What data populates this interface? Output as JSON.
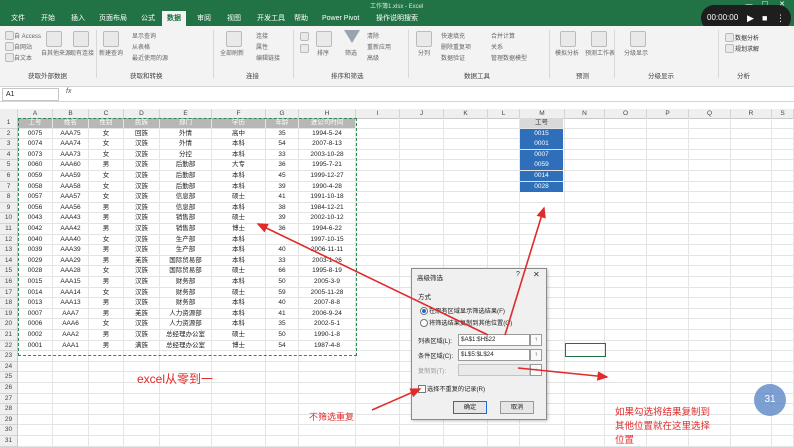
{
  "window": {
    "title": "工作簿1.xlsx - Excel",
    "controls": [
      "—",
      "☐",
      "✕"
    ]
  },
  "tabs": [
    "文件",
    "开始",
    "插入",
    "页面布局",
    "公式",
    "数据",
    "审阅",
    "视图",
    "开发工具",
    "帮助",
    "Power Pivot",
    "操作说明搜索"
  ],
  "active_tab": "数据",
  "video": {
    "time": "00:00:00"
  },
  "ribbon": {
    "groups": [
      "获取外部数据",
      "获取和转换",
      "连接",
      "排序和筛选",
      "数据工具",
      "预测",
      "分级显示",
      "分析"
    ],
    "items": {
      "access": "自 Access",
      "web": "自网站",
      "text": "自文本",
      "other": "自其他来源",
      "existing": "现有连接",
      "new_query": "新建查询",
      "show_query": "显示查询",
      "from_table": "从表格",
      "recent": "最近使用的源",
      "refresh": "全部刷新",
      "conn": "连接",
      "props": "属性",
      "edit_links": "编辑链接",
      "sort": "排序",
      "filter": "筛选",
      "clear": "清除",
      "reapply": "重新应用",
      "advanced": "高级",
      "split": "分列",
      "flash_fill": "快速填充",
      "remove_dup": "删除重复项",
      "validation": "数据验证",
      "consolidate": "合并计算",
      "relations": "关系",
      "manage_model": "管理数据模型",
      "what_if": "模拟分析",
      "forecast": "预测工作表",
      "outline": "分级显示",
      "data_analysis": "数据分析",
      "solver": "规划求解"
    }
  },
  "formula_bar": {
    "name_box": "A1",
    "fx": "fx"
  },
  "columns": [
    "A",
    "B",
    "C",
    "D",
    "E",
    "F",
    "G",
    "H",
    "I",
    "J",
    "K",
    "L",
    "M",
    "N",
    "O",
    "P",
    "Q",
    "R",
    "S"
  ],
  "rows": [
    "1",
    "2",
    "3",
    "4",
    "5",
    "6",
    "7",
    "8",
    "9",
    "10",
    "11",
    "12",
    "13",
    "14",
    "15",
    "16",
    "17",
    "18",
    "19",
    "20",
    "21",
    "22",
    "23",
    "24",
    "25",
    "26",
    "27",
    "28",
    "29",
    "30",
    "31"
  ],
  "table": {
    "headers": [
      "工号",
      "姓名",
      "性别",
      "民族",
      "部门",
      "学历",
      "年龄",
      "进公司时间"
    ],
    "rows": [
      [
        "0075",
        "AAA75",
        "女",
        "回族",
        "外情",
        "高中",
        "35",
        "1994-5-24"
      ],
      [
        "0074",
        "AAA74",
        "女",
        "汉族",
        "外情",
        "本科",
        "54",
        "2007-8-13"
      ],
      [
        "0073",
        "AAA73",
        "女",
        "汉族",
        "分控",
        "本科",
        "33",
        "2003-10-28"
      ],
      [
        "0060",
        "AAA60",
        "男",
        "汉族",
        "后勤部",
        "大专",
        "36",
        "1995-7-21"
      ],
      [
        "0059",
        "AAA59",
        "女",
        "汉族",
        "后勤部",
        "本科",
        "45",
        "1999-12-27"
      ],
      [
        "0058",
        "AAA58",
        "女",
        "汉族",
        "后勤部",
        "本科",
        "39",
        "1990-4-28"
      ],
      [
        "0057",
        "AAA57",
        "女",
        "汉族",
        "信息部",
        "硕士",
        "41",
        "1991-10-18"
      ],
      [
        "0056",
        "AAA56",
        "男",
        "汉族",
        "信息部",
        "本科",
        "38",
        "1984-12-21"
      ],
      [
        "0043",
        "AAA43",
        "男",
        "汉族",
        "销售部",
        "硕士",
        "39",
        "2002-10-12"
      ],
      [
        "0042",
        "AAA42",
        "男",
        "汉族",
        "销售部",
        "博士",
        "36",
        "1994-6-22"
      ],
      [
        "0040",
        "AAA40",
        "女",
        "汉族",
        "生产部",
        "本科",
        "",
        "1997-10-15"
      ],
      [
        "0039",
        "AAA39",
        "男",
        "汉族",
        "生产部",
        "本科",
        "40",
        "2006-11-11"
      ],
      [
        "0029",
        "AAA29",
        "男",
        "羌族",
        "国际贸易部",
        "本科",
        "33",
        "2003-1-26"
      ],
      [
        "0028",
        "AAA28",
        "女",
        "汉族",
        "国际贸易部",
        "硕士",
        "66",
        "1995-8-19"
      ],
      [
        "0015",
        "AAA15",
        "男",
        "汉族",
        "财务部",
        "本科",
        "50",
        "2005-3-9"
      ],
      [
        "0014",
        "AAA14",
        "女",
        "汉族",
        "财务部",
        "硕士",
        "59",
        "2005-11-28"
      ],
      [
        "0013",
        "AAA13",
        "男",
        "汉族",
        "财务部",
        "本科",
        "40",
        "2007-8-8"
      ],
      [
        "0007",
        "AAA7",
        "男",
        "羌族",
        "人力资源部",
        "本科",
        "41",
        "2006-9-24"
      ],
      [
        "0006",
        "AAA6",
        "女",
        "汉族",
        "人力资源部",
        "本科",
        "35",
        "2002-5-1"
      ],
      [
        "0002",
        "AAA2",
        "男",
        "汉族",
        "总经理办公室",
        "硕士",
        "50",
        "1990-1-8"
      ],
      [
        "0001",
        "AAA1",
        "男",
        "满族",
        "总经理办公室",
        "博士",
        "54",
        "1987-4-8"
      ]
    ]
  },
  "criteria": {
    "header": "工号",
    "values": [
      "0015",
      "0001",
      "0007",
      "0059",
      "0014",
      "0028"
    ]
  },
  "dialog": {
    "title": "高级筛选",
    "help": "?",
    "close": "✕",
    "method_label": "方式",
    "opt1": "在原有区域显示筛选结果(F)",
    "opt2": "将筛选结果复制到其他位置(O)",
    "list_label": "列表区域(L):",
    "list_value": "$A$1:$H$22",
    "criteria_label": "条件区域(C):",
    "criteria_value": "$L$5:$L$24",
    "copy_label": "复制到(T):",
    "copy_value": "",
    "unique_label": "选择不重复的记录(R)",
    "ok": "确定",
    "cancel": "取消"
  },
  "annotations": {
    "excel": "excel从零到一",
    "no_dup": "不筛选重复",
    "copy_note_1": "如果勾选将结果复制到",
    "copy_note_2": "其他位置就在这里选择",
    "copy_note_3": "位置"
  },
  "page_badge": "31",
  "colors": {
    "excel_green": "#217346",
    "annotation_red": "#e12a2a",
    "criteria_blue": "#2f6eb8"
  }
}
